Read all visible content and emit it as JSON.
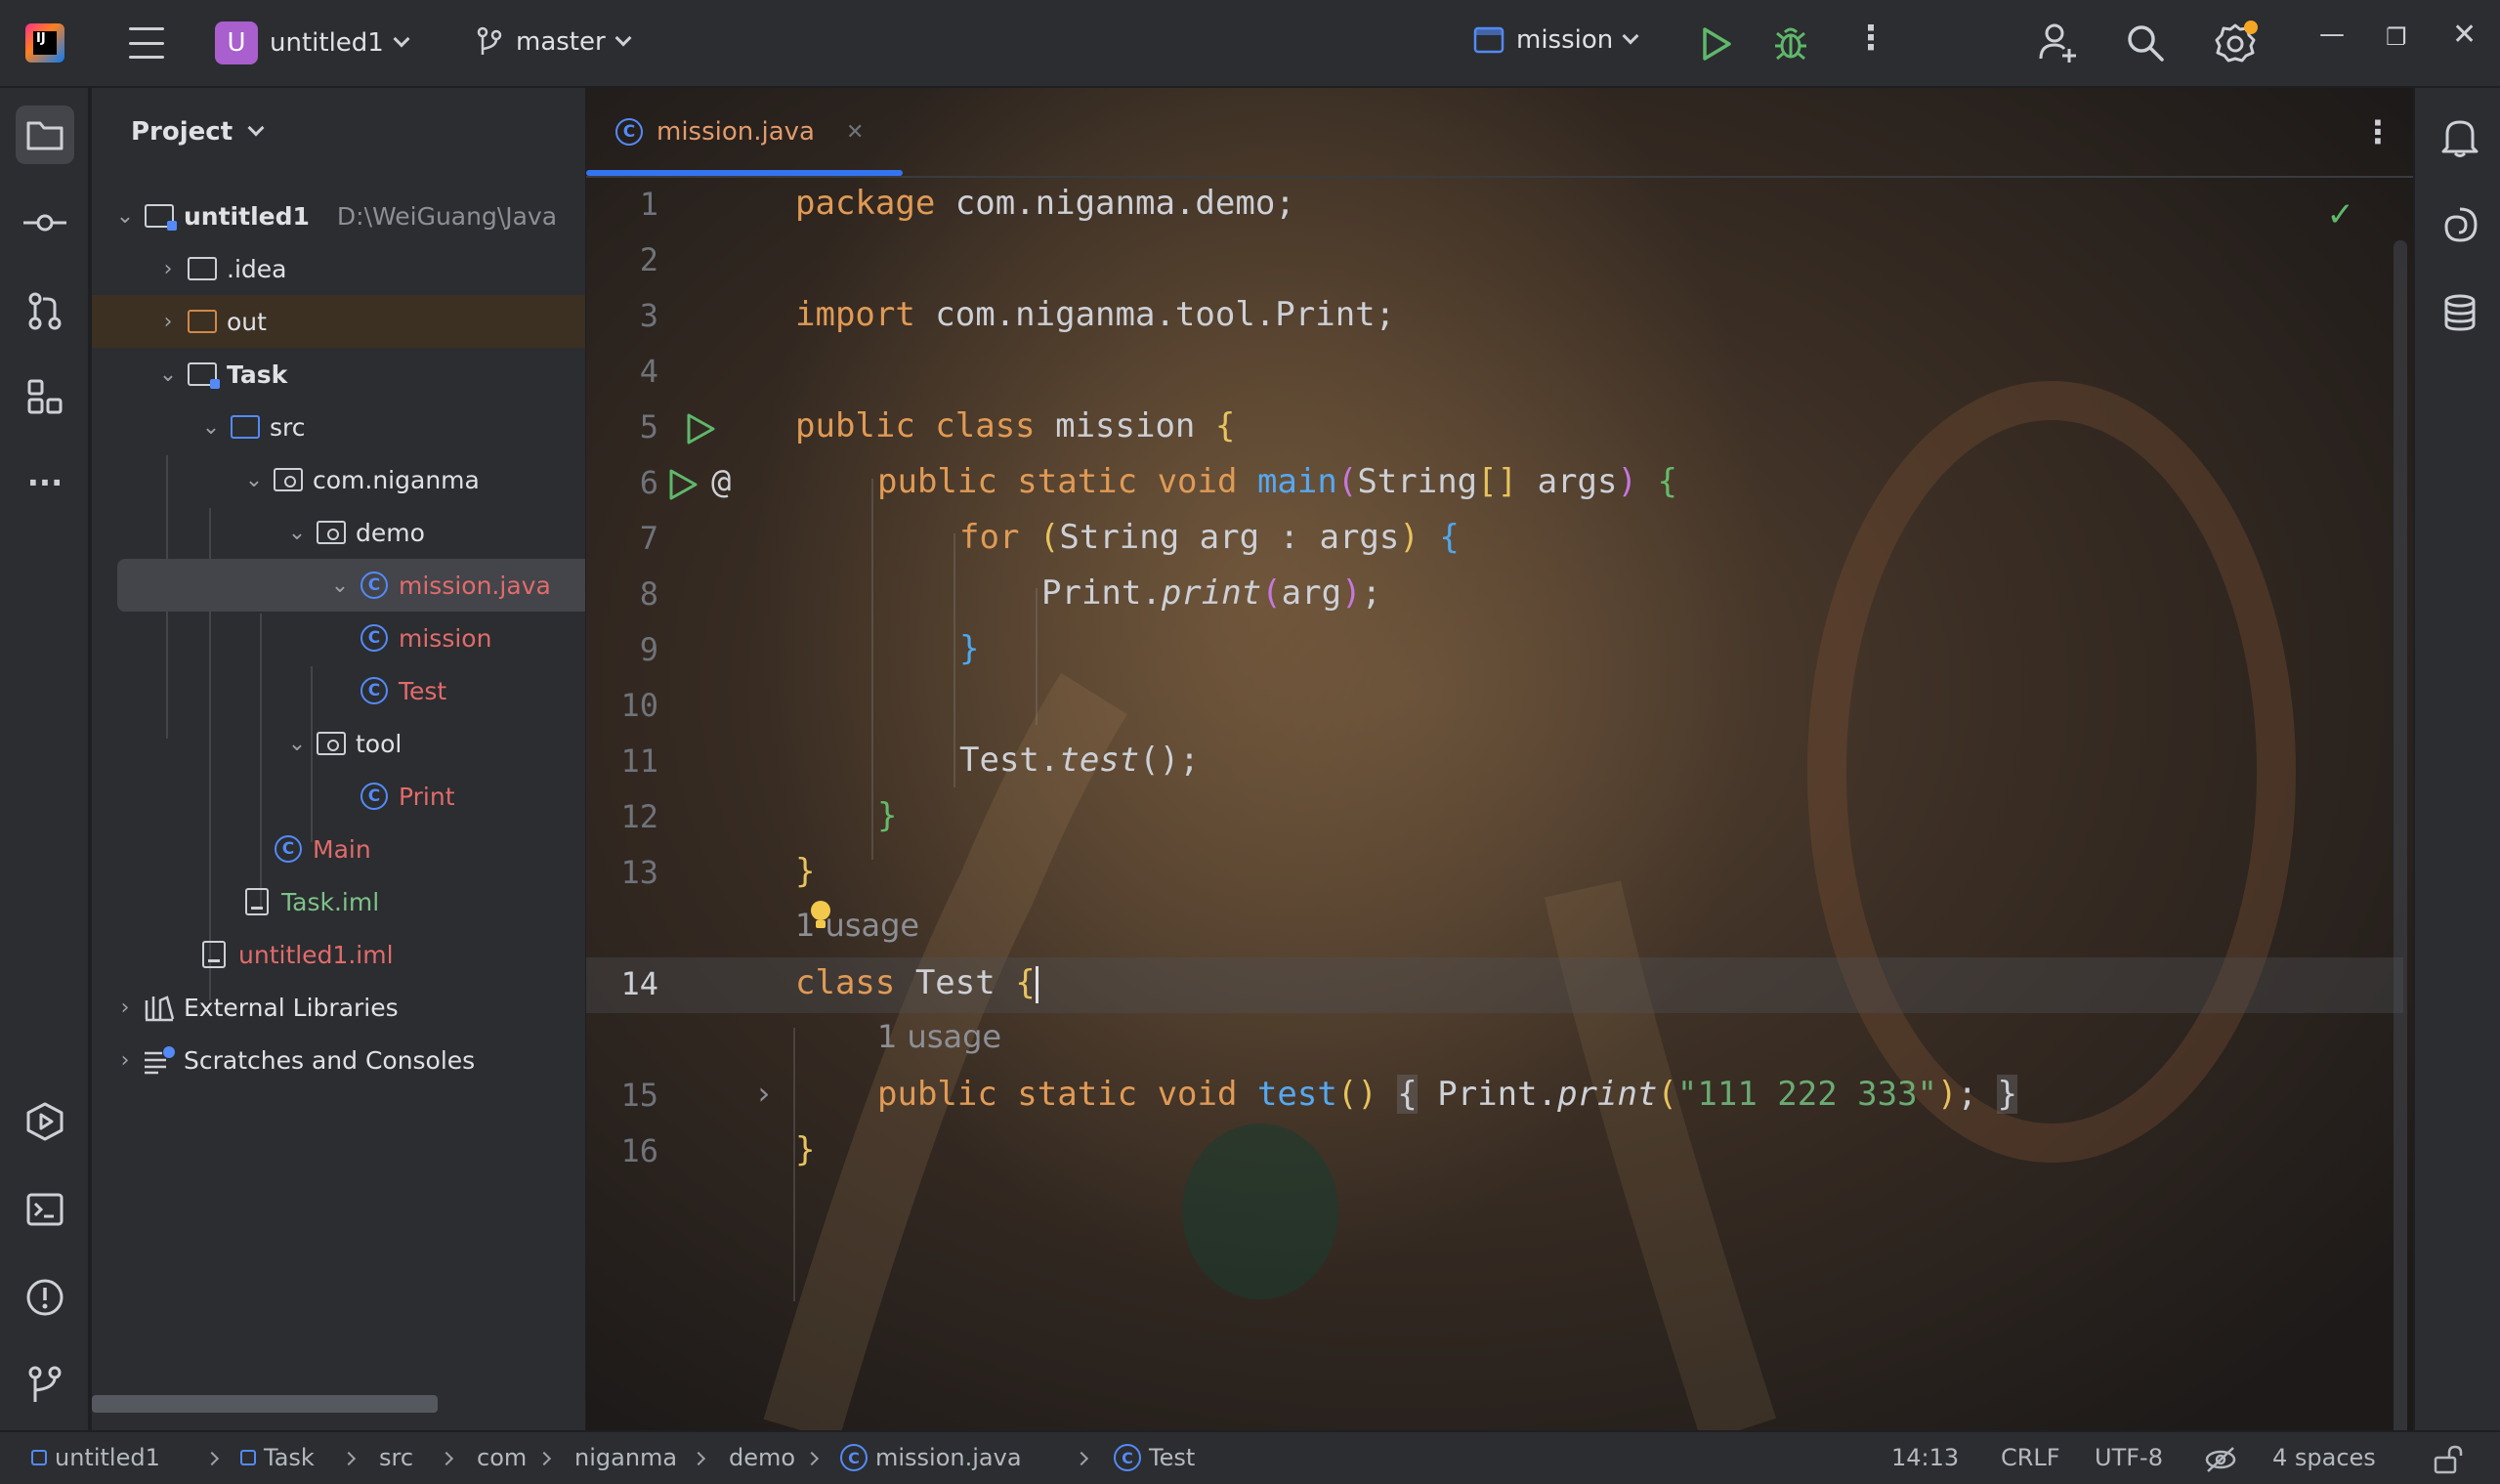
{
  "titlebar": {
    "project_badge": "U",
    "project_name": "untitled1",
    "branch": "master",
    "run_config": "mission",
    "icons": [
      "app-logo-icon",
      "main-menu-icon",
      "branch-icon",
      "run-config-icon",
      "run-icon",
      "debug-icon",
      "more-icon",
      "add-user-icon",
      "search-icon",
      "settings-icon",
      "minimize-icon",
      "restore-icon",
      "close-icon"
    ],
    "accent_run": "#5fb86b",
    "accent_badge": "#a95fcd",
    "settings_dot": "#f5a623"
  },
  "left_strip": {
    "icons": [
      "project-icon",
      "commit-icon",
      "pull-requests-icon",
      "structure-icon",
      "more-tools-icon",
      "services-icon",
      "terminal-icon",
      "problems-icon",
      "git-icon"
    ]
  },
  "project_panel": {
    "title": "Project",
    "tree": [
      {
        "label": "untitled1",
        "path": "D:\\WeiGuang\\Java",
        "icon": "module-folder-icon"
      },
      {
        "label": ".idea",
        "icon": "folder-icon"
      },
      {
        "label": "out",
        "icon": "excluded-folder-icon"
      },
      {
        "label": "Task",
        "icon": "module-folder-icon"
      },
      {
        "label": "src",
        "icon": "source-folder-icon"
      },
      {
        "label": "com.niganma",
        "icon": "package-icon"
      },
      {
        "label": "demo",
        "icon": "package-icon"
      },
      {
        "label": "mission.java",
        "icon": "class-icon"
      },
      {
        "label": "mission",
        "icon": "class-icon"
      },
      {
        "label": "Test",
        "icon": "class-icon"
      },
      {
        "label": "tool",
        "icon": "package-icon"
      },
      {
        "label": "Print",
        "icon": "class-icon"
      },
      {
        "label": "Main",
        "icon": "class-icon"
      },
      {
        "label": "Task.iml",
        "icon": "iml-file-icon"
      },
      {
        "label": "untitled1.iml",
        "icon": "iml-file-icon"
      },
      {
        "label": "External Libraries",
        "icon": "libraries-icon"
      },
      {
        "label": "Scratches and Consoles",
        "icon": "scratches-icon"
      }
    ]
  },
  "editor": {
    "tab_label": "mission.java",
    "class_glyph": "C",
    "line_numbers": [
      "1",
      "2",
      "3",
      "4",
      "5",
      "6",
      "7",
      "8",
      "9",
      "10",
      "11",
      "12",
      "13",
      "14",
      "15",
      "16"
    ],
    "hint_usage_1": "1 usage",
    "hint_usage_2": "1 usage",
    "code": {
      "l1_kw": "package",
      "l1_rest": " com.niganma.demo;",
      "l3_kw": "import",
      "l3_rest": " com.niganma.tool.Print;",
      "l5_kw": "public class",
      "l5_name": " mission ",
      "l5_brace": "{",
      "l6_kw": "public static void",
      "l6_fn": "main",
      "l6_p1": "(",
      "l6_type": "String",
      "l6_arr": "[]",
      "l6_args": " args",
      "l6_p2": ")",
      "l6_brace": "{",
      "l7_kw": "for",
      "l7_p1": "(",
      "l7_body": "String arg : args",
      "l7_p2": ")",
      "l7_brace": "{",
      "l8_obj": "Print.",
      "l8_fn": "print",
      "l8_p1": "(",
      "l8_arg": "arg",
      "l8_p2": ")",
      "l8_end": ";",
      "l9_brace": "}",
      "l11_obj": "Test.",
      "l11_fn": "test",
      "l11_call": "();",
      "l12_brace": "}",
      "l13_brace": "}",
      "l14_kw": "class",
      "l14_name": " Test ",
      "l14_brace": "{",
      "l15_kw": "public static void",
      "l15_fn": "test",
      "l15_parens": "()",
      "l15_open": "{",
      "l15_obj": " Print.",
      "l15_call": "print",
      "l15_p1": "(",
      "l15_str": "\"111 222 333\"",
      "l15_p2": ")",
      "l15_end": "; ",
      "l15_close": "}",
      "l16_brace": "}"
    }
  },
  "right_strip": {
    "icons": [
      "notifications-icon",
      "ai-assistant-icon",
      "database-icon"
    ]
  },
  "statusbar": {
    "crumbs": [
      "untitled1",
      "Task",
      "src",
      "com",
      "niganma",
      "demo",
      "mission.java",
      "Test"
    ],
    "position": "14:13",
    "line_sep": "CRLF",
    "encoding": "UTF-8",
    "indent": "4 spaces"
  }
}
